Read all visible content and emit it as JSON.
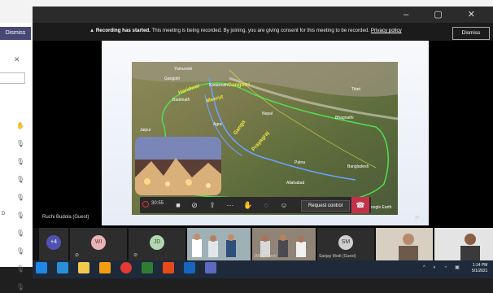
{
  "window": {
    "controls": "–  ▢  ✕"
  },
  "left_panel": {
    "dismiss_label": "Dismiss",
    "close_glyph": "✕",
    "rows": [
      {
        "label": "",
        "icon": "✋"
      },
      {
        "label": "",
        "icon": "🎙"
      },
      {
        "label": "",
        "icon": "🎙"
      },
      {
        "label": "",
        "icon": "🎙"
      },
      {
        "label": "",
        "icon": "🎙"
      },
      {
        "label": "D",
        "icon": "🎙"
      },
      {
        "label": "",
        "icon": "🎙"
      },
      {
        "label": "",
        "icon": "🎙"
      },
      {
        "label": "",
        "icon": "🎙"
      },
      {
        "label": "",
        "icon": "🎙"
      }
    ]
  },
  "banner": {
    "bold": "Recording has started.",
    "text": " This meeting is being recorded. By joining, you are giving consent for this meeting to be recorded.",
    "link": "Privacy policy",
    "dismiss_label": "Dismiss"
  },
  "map": {
    "labels": [
      "Yamunotri",
      "Gangotri",
      "Kedarnath",
      "Badrinath",
      "Haridwar",
      "Meerut",
      "Kanpur",
      "Allahabad",
      "Varanasi",
      "Patna",
      "Nepal",
      "Tibet",
      "Bhagirathi",
      "Alaknanda",
      "Kolkata",
      "Bangladesh",
      "Jaipur",
      "Agra",
      "Lucknow",
      "Farakka",
      "Dhaka",
      "Rajshahi"
    ],
    "river_labels": [
      "Haridwar",
      "Meerut",
      "Ganga",
      "Gangotri",
      "Yamuna",
      "Prayagraj"
    ],
    "watermark": "Google Earth"
  },
  "controls": {
    "timer": "30:55",
    "request_label": "Request control",
    "slide_number": "37"
  },
  "presenter_name": "Ruchi Budola (Guest)",
  "participants": [
    {
      "initials": "+4",
      "name": "",
      "color": "#4f52b2"
    },
    {
      "initials": "WI",
      "name": "",
      "color": "#e8b4b8"
    },
    {
      "initials": "JD",
      "name": "",
      "color": "#b5d6b2"
    },
    {
      "initials": "",
      "name": "",
      "color": ""
    },
    {
      "initials": "",
      "name": "JMP (Guest)",
      "color": ""
    },
    {
      "initials": "SM",
      "name": "Sanjay Modi (Guest)",
      "color": "#cfcfcf"
    },
    {
      "initials": "",
      "name": "",
      "color": ""
    },
    {
      "initials": "",
      "name": "",
      "color": ""
    }
  ],
  "taskbar": {
    "time": "1:14 PM",
    "date": "5/1/2021"
  }
}
